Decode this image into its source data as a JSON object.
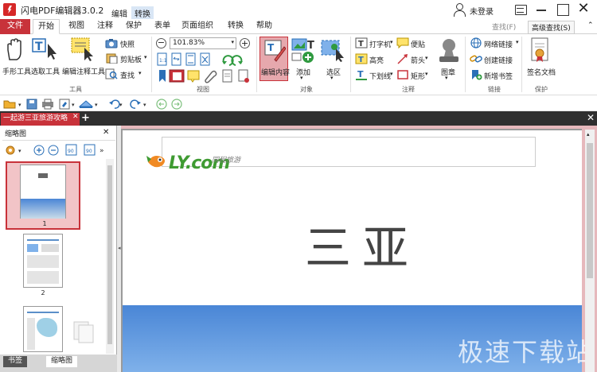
{
  "app": {
    "title": "闪电PDF编辑器3.0.2",
    "context_tabs": [
      "编辑",
      "转换"
    ],
    "login": "未登录"
  },
  "ribbon_tabs": [
    "文件",
    "开始",
    "视图",
    "注释",
    "保护",
    "表单",
    "页面组织",
    "转换",
    "帮助"
  ],
  "quick_find": {
    "search": "查找(F)",
    "advanced": "高级查找(S)"
  },
  "ribbon": {
    "tools": {
      "hand": "手形工具",
      "select": "选取工具",
      "annotate": "编辑注释工具",
      "snapshot": "快照",
      "clipboard": "剪贴板",
      "find": "查找",
      "group": "工具"
    },
    "view": {
      "zoom": "101.83%",
      "group": "视图"
    },
    "objects": {
      "edit_content": "编辑内容",
      "add": "添加",
      "select_area": "选区",
      "group": "对象"
    },
    "annotations": {
      "typewriter": "打字机",
      "highlight": "高亮",
      "underline": "下划线",
      "note": "便贴",
      "arrow": "箭头",
      "rect": "矩形",
      "stamp": "图章",
      "group": "注释"
    },
    "links": {
      "web_link": "网络链接",
      "create_link": "创建链接",
      "new_bookmark": "新增书签",
      "group": "链接"
    },
    "protect": {
      "sign": "签名文档",
      "group": "保护"
    }
  },
  "document_tab": "一起游三亚旅游攻略",
  "left_panel": {
    "title": "缩略图",
    "page_numbers": [
      "1",
      "2"
    ],
    "bottom_tabs": [
      "书签",
      "缩略图"
    ]
  },
  "page": {
    "logo": "LY.com",
    "logo_sub": "同程旅游",
    "title": "三亚"
  },
  "watermark": "极速下载站",
  "colors": {
    "accent": "#c8323a",
    "logo_green": "#3f9b32",
    "sea_blue": "#4a86d6"
  }
}
